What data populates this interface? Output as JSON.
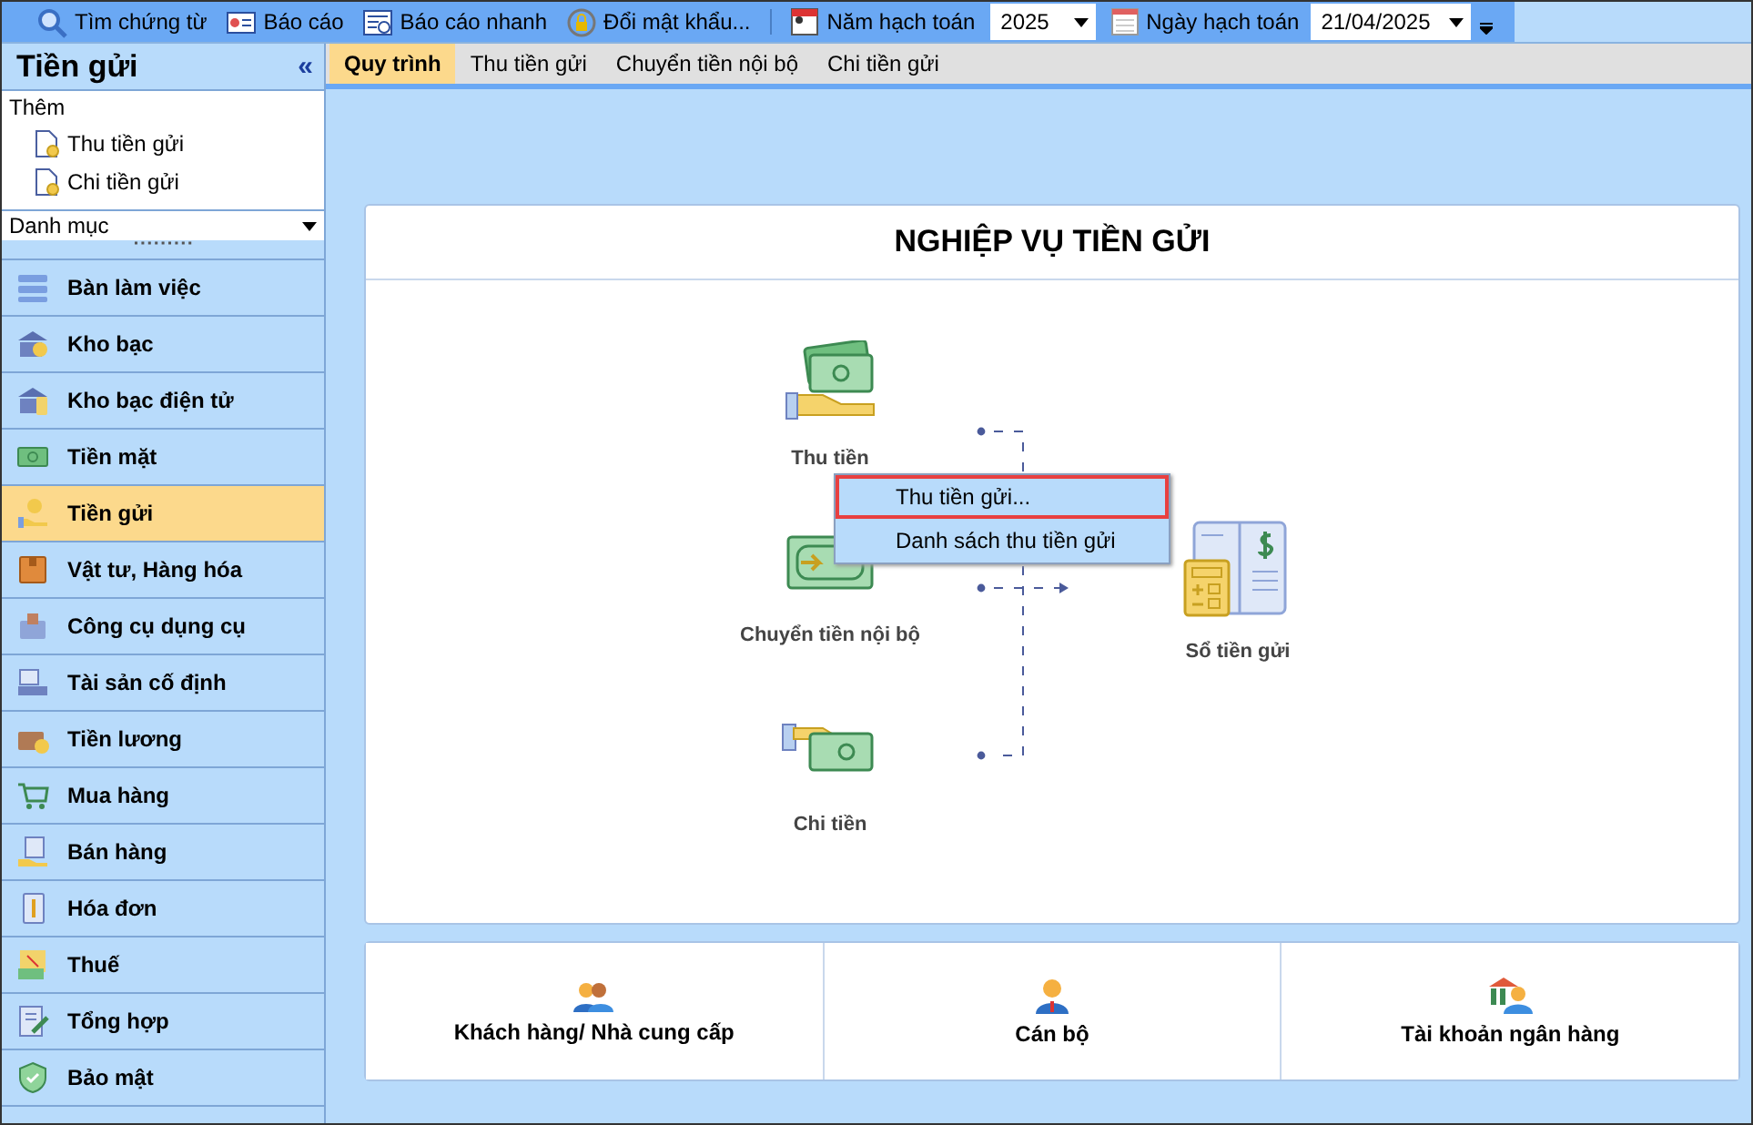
{
  "toolbar": {
    "buttons": [
      {
        "label": "Tìm chứng từ",
        "kind": "search"
      },
      {
        "label": "Báo cáo",
        "kind": "report"
      },
      {
        "label": "Báo cáo nhanh",
        "kind": "quick"
      },
      {
        "label": "Đổi mật khẩu...",
        "kind": "password"
      }
    ],
    "year": {
      "label": "Năm hạch toán",
      "value": "2025"
    },
    "date": {
      "label": "Ngày hạch toán",
      "value": "21/04/2025"
    }
  },
  "sidebar": {
    "title": "Tiền gửi",
    "collapse": "«",
    "add": {
      "title": "Thêm",
      "items": [
        {
          "label": "Thu tiền gửi"
        },
        {
          "label": "Chi tiền gửi"
        }
      ]
    },
    "category": {
      "value": "Danh mục"
    },
    "modules": [
      {
        "label": "Bàn làm việc",
        "selected": false
      },
      {
        "label": "Kho bạc",
        "selected": false
      },
      {
        "label": "Kho bạc điện tử",
        "selected": false
      },
      {
        "label": "Tiền mặt",
        "selected": false
      },
      {
        "label": "Tiền gửi",
        "selected": true
      },
      {
        "label": "Vật tư, Hàng hóa",
        "selected": false
      },
      {
        "label": "Công cụ dụng cụ",
        "selected": false
      },
      {
        "label": "Tài sản cố định",
        "selected": false
      },
      {
        "label": "Tiền lương",
        "selected": false
      },
      {
        "label": "Mua hàng",
        "selected": false
      },
      {
        "label": "Bán hàng",
        "selected": false
      },
      {
        "label": "Hóa đơn",
        "selected": false
      },
      {
        "label": "Thuế",
        "selected": false
      },
      {
        "label": "Tổng hợp",
        "selected": false
      },
      {
        "label": "Bảo mật",
        "selected": false
      }
    ]
  },
  "tabs": [
    {
      "label": "Quy trình",
      "selected": true
    },
    {
      "label": "Thu tiền gửi",
      "selected": false
    },
    {
      "label": "Chuyển tiền nội bộ",
      "selected": false
    },
    {
      "label": "Chi tiền gửi",
      "selected": false
    }
  ],
  "process": {
    "title": "NGHIỆP VỤ TIỀN GỬI",
    "nodes": [
      {
        "label": "Thu tiền",
        "kind": "receive"
      },
      {
        "label": "Chuyển tiền nội bộ",
        "kind": "transfer"
      },
      {
        "label": "Chi tiền",
        "kind": "pay"
      },
      {
        "label": "Sổ tiền gửi",
        "kind": "ledger"
      }
    ],
    "menu": [
      {
        "label": "Thu tiền gửi...",
        "selected": true
      },
      {
        "label": "Danh sách thu tiền gửi",
        "selected": false
      }
    ]
  },
  "shortcuts": [
    {
      "label": "Khách hàng/ Nhà cung cấp",
      "kind": "customers"
    },
    {
      "label": "Cán bộ",
      "kind": "staff"
    },
    {
      "label": "Tài khoản ngân hàng",
      "kind": "bank"
    }
  ]
}
